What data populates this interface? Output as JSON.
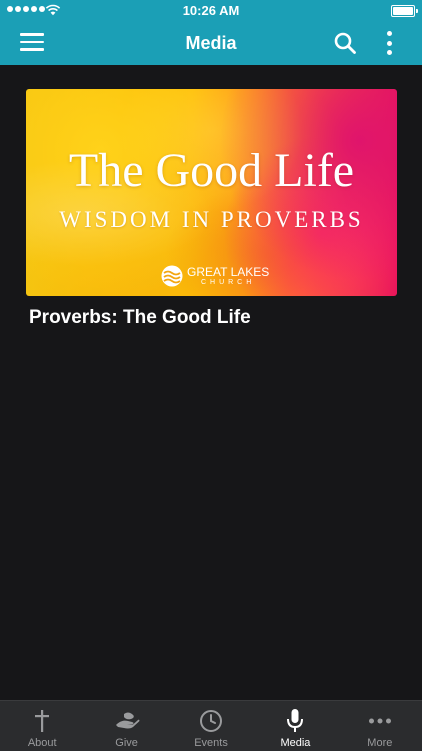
{
  "status_bar": {
    "time": "10:26 AM"
  },
  "nav": {
    "title": "Media"
  },
  "media": {
    "items": [
      {
        "title": "Proverbs: The Good Life",
        "artwork": {
          "headline": "The Good Life",
          "subhead": "WISDOM IN PROVERBS",
          "logo_line1": "GREAT LAKES",
          "logo_line2": "CHURCH"
        }
      }
    ]
  },
  "tab_bar": {
    "tabs": [
      {
        "label": "About",
        "icon": "cross-icon",
        "active": false
      },
      {
        "label": "Give",
        "icon": "giving-hand-icon",
        "active": false
      },
      {
        "label": "Events",
        "icon": "clock-icon",
        "active": false
      },
      {
        "label": "Media",
        "icon": "microphone-icon",
        "active": true
      },
      {
        "label": "More",
        "icon": "more-dots-icon",
        "active": false
      }
    ]
  },
  "colors": {
    "nav_background": "#1b9fb6",
    "page_background": "#161618",
    "tab_bar_background": "#2b2c2e",
    "tab_active": "#ffffff",
    "tab_inactive": "#9a9b9d"
  }
}
